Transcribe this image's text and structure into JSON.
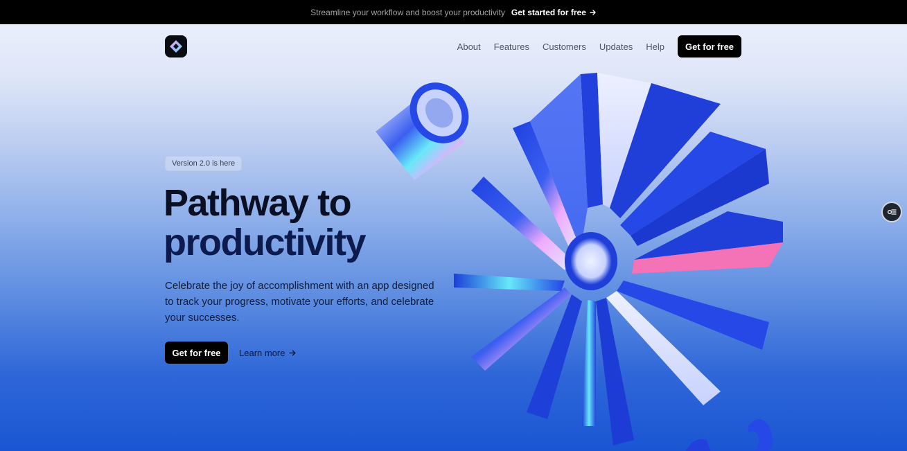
{
  "announcement": {
    "message": "Streamline your workflow and boost your productivity",
    "cta_label": "Get started for free",
    "cta_icon": "arrow-right-icon"
  },
  "nav": {
    "logo_icon": "diamond-logo-icon",
    "links": [
      "About",
      "Features",
      "Customers",
      "Updates",
      "Help"
    ],
    "cta_label": "Get for free"
  },
  "hero": {
    "badge": "Version 2.0 is here",
    "headline_line1": "Pathway to",
    "headline_line2": "productivity",
    "description": "Celebrate the joy of accomplishment with an app designed to track your progress, motivate your efforts, and celebrate your successes.",
    "primary_cta": "Get for free",
    "secondary_cta": "Learn more",
    "secondary_cta_icon": "arrow-right-icon"
  },
  "floating_button_icon": "settings-toggle-icon",
  "colors": {
    "accent": "#1a56d3",
    "button": "#000000",
    "headline": "#0a0f24"
  }
}
